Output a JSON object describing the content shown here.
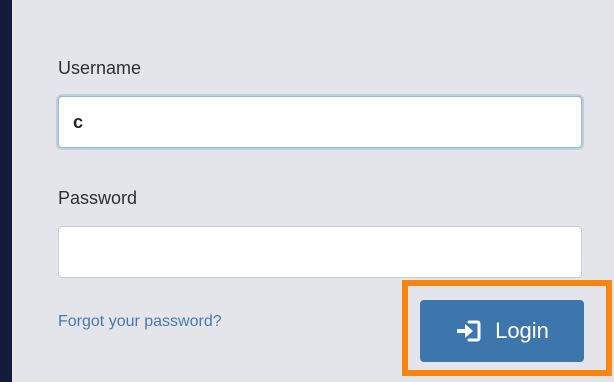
{
  "form": {
    "username_label": "Username",
    "username_value": "c",
    "password_label": "Password",
    "password_value": "",
    "forgot_link": "Forgot your password?",
    "login_label": "Login",
    "login_icon": "sign-in-icon"
  },
  "colors": {
    "accent": "#3d76ad",
    "highlight": "#f7850f",
    "link": "#4a78a9",
    "background": "#141a3a",
    "panel": "#e4e5ea"
  }
}
